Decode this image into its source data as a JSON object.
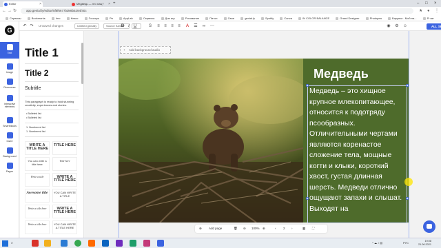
{
  "browser": {
    "tabs": [
      {
        "title": "Editor",
        "color": "#3b63e0",
        "active": true
      },
      {
        "title": "Медведь — это хищ?",
        "color": "#e33",
        "active": false
      }
    ],
    "url": "app.genial.ly/editor/5f8f6677bde8b5294f40c",
    "bookmarks": [
      "Сервисы",
      "Bookmarks",
      "Imo",
      "Класс",
      "Госслуж",
      "Рв",
      "AppLab",
      "Сервисы",
      "Для игр",
      "Рисование",
      "Питон",
      "Свое",
      "genial.ly",
      "Spotify",
      "Canva",
      "IN COLOR BALANCE",
      "Grand Designer",
      "Photopea",
      "Бирунка - Мой на...",
      "Я чат"
    ]
  },
  "rail": {
    "logo": "G",
    "items": [
      {
        "label": "Text",
        "active": true
      },
      {
        "label": "Image",
        "active": false
      },
      {
        "label": "Resources",
        "active": false
      },
      {
        "label": "Interactive elements",
        "active": false
      },
      {
        "label": "Smartblocks",
        "active": false
      },
      {
        "label": "Insert",
        "active": false
      },
      {
        "label": "Background",
        "active": false
      },
      {
        "label": "Pages",
        "active": false
      }
    ]
  },
  "toolbar": {
    "title": "Unsaved changes",
    "untitled": "Untitled genially",
    "font": "Source Sans P",
    "size": "",
    "buttons": [
      "B",
      "I",
      "U",
      "S",
      "≡",
      "≡",
      "≡",
      "≡",
      "A"
    ],
    "share_label": "ALL SET!"
  },
  "panel": {
    "title1": "Title 1",
    "title2": "Title 2",
    "subtitle": "Subtitle",
    "paragraph": "This paragraph is ready to hold stunning creativity, experiences and stories.",
    "bullets": [
      "Bulleted list",
      "Bulleted list"
    ],
    "numbered": [
      "1. Numbered list",
      "1. Numbered list"
    ],
    "templates": [
      "WRITE A TITLE HERE",
      "TITLE HERE",
      "You can write a title here",
      "Title here",
      "Write a title",
      "WRITE A TITLE HERE",
      "Awesome title",
      "YOU CAN WRITE A TITLE",
      "Write a title here",
      "WRITE A TITLE HERE",
      "Write a title here",
      "YOU CAN WRITE A TITLE HERE"
    ]
  },
  "canvas": {
    "add_audio": "Add background audio",
    "heading": "Медведь",
    "body": "Медведь – это хищное крупное млекопитающее, относится к подотряду псообразных. Отличительными чертами являются коренастое сложение тела, мощные когти и клыки, короткий хвост, густая длинная шерсть. Медведи отлично ощущают запахи и слышат. Выходят на",
    "green": "#4e6b2b"
  },
  "bottombar": {
    "add_page": "Add page",
    "zoom": "100%",
    "page": "2"
  },
  "taskbar": {
    "time": "19:08",
    "date": "21.06.2021",
    "lang": "РУС"
  }
}
